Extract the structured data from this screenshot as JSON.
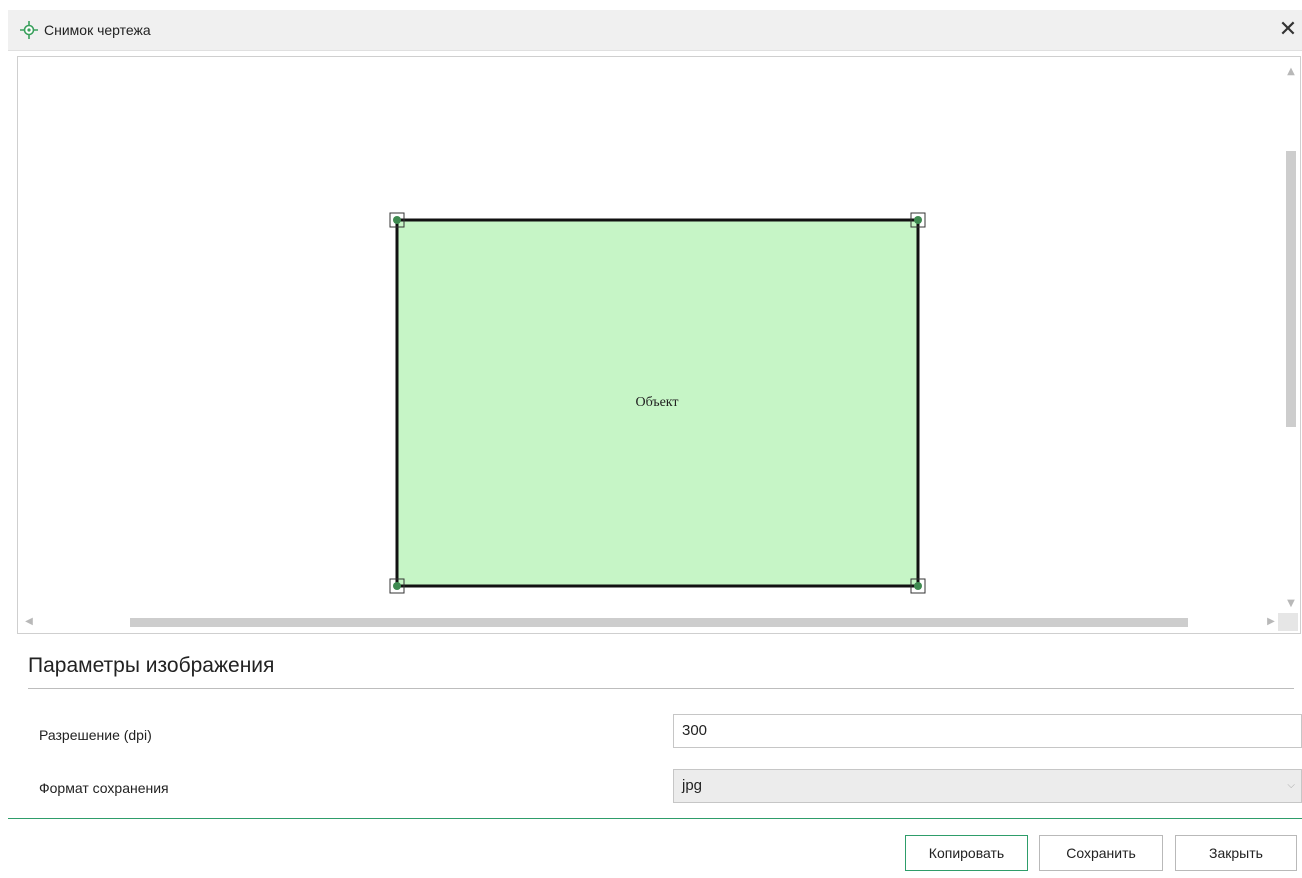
{
  "window": {
    "title": "Снимок чертежа",
    "app_icon": "crosshair-target-icon",
    "close_icon": "close-icon",
    "close_glyph": "✕"
  },
  "drawing": {
    "object_label": "Объект",
    "fill_color": "#c6f5c6",
    "stroke_color": "#111111",
    "vertex_color": "#3e8a50"
  },
  "scrollbars": {
    "up_glyph": "▲",
    "down_glyph": "▼",
    "left_glyph": "◀",
    "right_glyph": "▶"
  },
  "params": {
    "section_title": "Параметры изображения",
    "resolution_label": "Разрешение (dpi)",
    "resolution_value": "300",
    "format_label": "Формат сохранения",
    "format_value": "jpg",
    "select_arrow_glyph": "⌵"
  },
  "buttons": {
    "copy": "Копировать",
    "save": "Сохранить",
    "close": "Закрыть"
  },
  "colors": {
    "accent": "#2e9d6a"
  }
}
